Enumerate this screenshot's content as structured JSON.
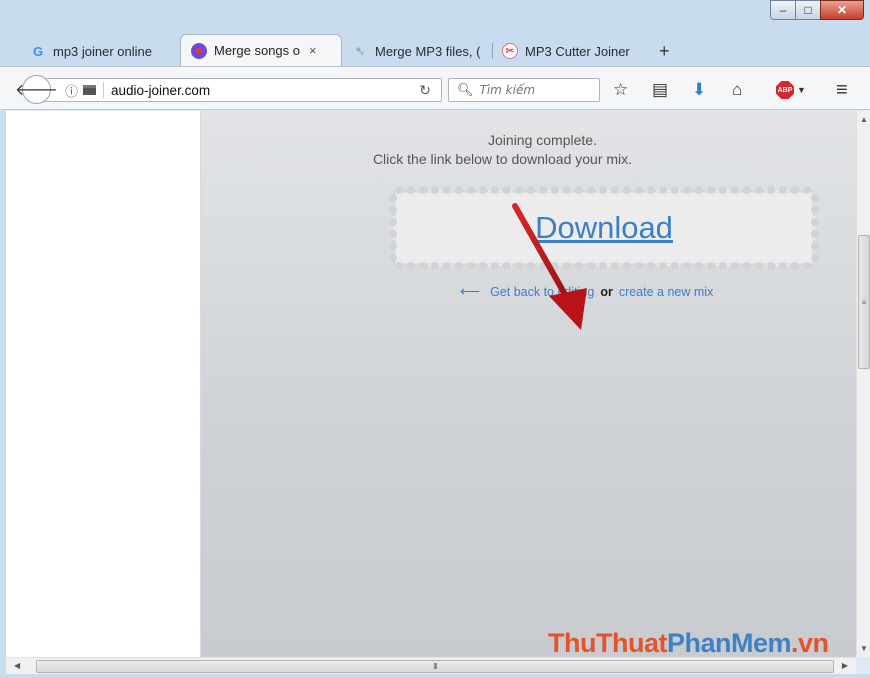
{
  "browser": {
    "tabs": [
      {
        "label": "mp3 joiner online",
        "icon": "google-icon",
        "active": false
      },
      {
        "label": "Merge songs o",
        "icon": "audio-joiner-icon",
        "active": true,
        "close": "×"
      },
      {
        "label": "Merge MP3 files, (",
        "icon": "arrow-site-icon",
        "active": false
      },
      {
        "label": "MP3 Cutter Joiner",
        "icon": "mp3cutter-icon",
        "active": false
      }
    ],
    "new_tab": "+",
    "url": "audio-joiner.com",
    "search_placeholder": "Tìm kiếm",
    "window_controls": {
      "minimize": "–",
      "maximize": "□",
      "close": "✕"
    }
  },
  "page": {
    "message_line1": "Joining complete.",
    "message_line2": "Click the link below to download your mix.",
    "download_label": "Download",
    "back_arrow": "⟵",
    "back_link": "Get back to editing",
    "or_text": "or",
    "new_mix_link": "create a new mix"
  },
  "scrollbars": {
    "h_thumb_grip": "III",
    "v_thumb_grip": "≡"
  },
  "watermark": {
    "part1": "ThuThuat",
    "part2": "PhanMem",
    "part3": ".vn"
  },
  "colors": {
    "link": "#3b7fc4",
    "annotation_arrow": "#c0171b",
    "watermark_red": "#e4542c",
    "watermark_blue": "#3d82c6"
  }
}
